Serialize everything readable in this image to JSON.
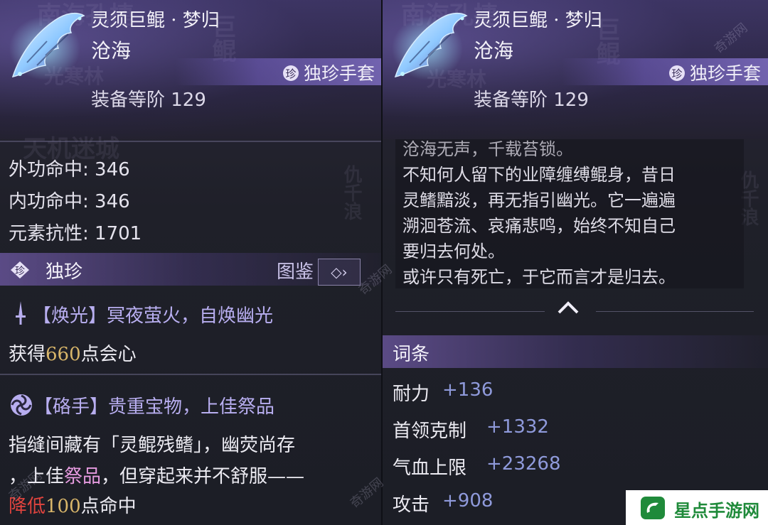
{
  "item": {
    "name": "灵须巨鲲 · 梦归",
    "subname": "沧海",
    "rarity_badge": "珍",
    "rarity_label": "独珍手套",
    "tier_label": "装备等阶 129"
  },
  "background_text": {
    "left_top": "南海孔捷",
    "left_mid": "光寒林",
    "left_vertical": "巨鲲",
    "left_lower": "天机迷城",
    "left_vertical2": "仇千浪",
    "right_top": "南海孔捷",
    "right_mid": "光寒林",
    "right_vertical": "巨鲲",
    "right_vertical2": "仇千浪"
  },
  "stats": [
    {
      "label": "外功命中",
      "value": "346"
    },
    {
      "label": "内功命中",
      "value": "346"
    },
    {
      "label": "元素抗性",
      "value": "1701"
    }
  ],
  "unique_section": {
    "badge": "珍",
    "title": "独珍",
    "atlas_label": "图鉴",
    "atlas_button_icon": "◇›"
  },
  "effects": [
    {
      "icon": "sword-icon",
      "title": "【焕光】冥夜萤火，自焕幽光",
      "line_prefix": "获得",
      "line_number": "660",
      "line_suffix": "点会心"
    },
    {
      "icon": "swirl-icon",
      "title": "【硌手】贵重宝物，上佳祭品",
      "line1": "指缝间藏有「灵鲲残鳍」，幽荧尚存",
      "line2_prefix": "，上佳",
      "line2_highlight": "祭品",
      "line2_suffix": "，但穿起来并不舒服——",
      "line3_red": "降低",
      "line3_number": "100",
      "line3_suffix": "点命中"
    }
  ],
  "lore": {
    "lines": [
      "沧海无声，千载苔锁。",
      "不知何人留下的业障缠缚鲲身，昔日",
      "灵鳍黯淡，再无指引幽光。它一遍遍",
      "溯洄苍流、哀痛悲鸣，始终不知自己",
      "要归去何处。",
      "或许只有死亡，于它而言才是归去。"
    ]
  },
  "affix_section": {
    "title": "词条",
    "attributes": [
      {
        "name": "耐力",
        "value": "+136"
      },
      {
        "name": "首领克制",
        "value": "+1332"
      },
      {
        "name": "气血上限",
        "value": "+23268"
      },
      {
        "name": "攻击",
        "value": "+908"
      }
    ]
  },
  "watermarks": [
    "奇游网",
    "奇游网",
    "奇游网",
    "奇游网"
  ],
  "logo": {
    "text": "星点手游网"
  },
  "colors": {
    "accent_purple": "#b8aef0",
    "gold_number": "#d9b66a",
    "pink_highlight": "#e69be0",
    "red_negative": "#e0443e",
    "attr_value_blue": "#8f9adb",
    "logo_green": "#1f8a3a"
  }
}
